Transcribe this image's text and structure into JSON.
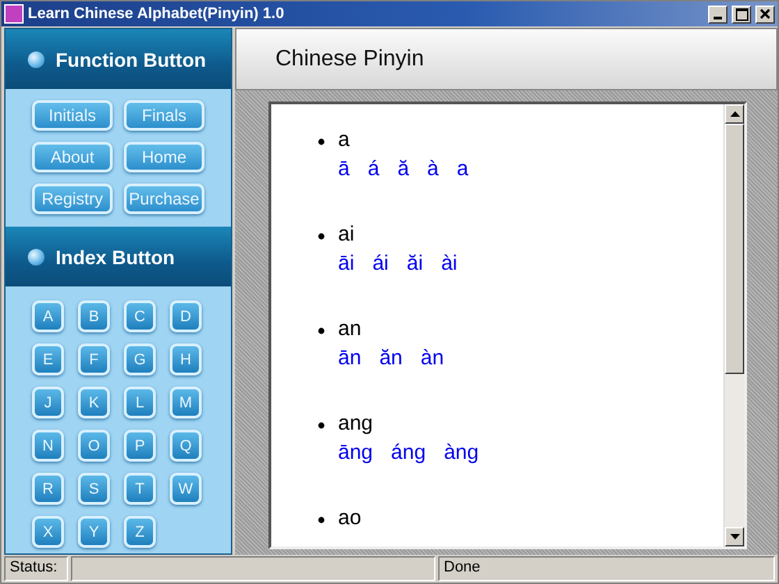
{
  "window": {
    "title": "Learn Chinese Alphabet(Pinyin) 1.0"
  },
  "sidebar": {
    "sections": [
      {
        "title": "Function Button",
        "kind": "function",
        "buttons": [
          "Initials",
          "Finals",
          "About",
          "Home",
          "Registry",
          "Purchase"
        ]
      },
      {
        "title": "Index Button",
        "kind": "index",
        "buttons": [
          "A",
          "B",
          "C",
          "D",
          "E",
          "F",
          "G",
          "H",
          "J",
          "K",
          "L",
          "M",
          "N",
          "O",
          "P",
          "Q",
          "R",
          "S",
          "T",
          "W",
          "X",
          "Y",
          "Z"
        ]
      }
    ]
  },
  "content": {
    "heading": "Chinese Pinyin",
    "entries": [
      {
        "syllable": "a",
        "tones": [
          "ā",
          "á",
          "ă",
          "à",
          "a"
        ]
      },
      {
        "syllable": "ai",
        "tones": [
          "āi",
          "ái",
          "ăi",
          "ài"
        ]
      },
      {
        "syllable": "an",
        "tones": [
          "ān",
          "ăn",
          "àn"
        ]
      },
      {
        "syllable": "ang",
        "tones": [
          "āng",
          "áng",
          "àng"
        ]
      },
      {
        "syllable": "ao"
      }
    ]
  },
  "status_bar": {
    "label": "Status:",
    "message": "Done"
  }
}
